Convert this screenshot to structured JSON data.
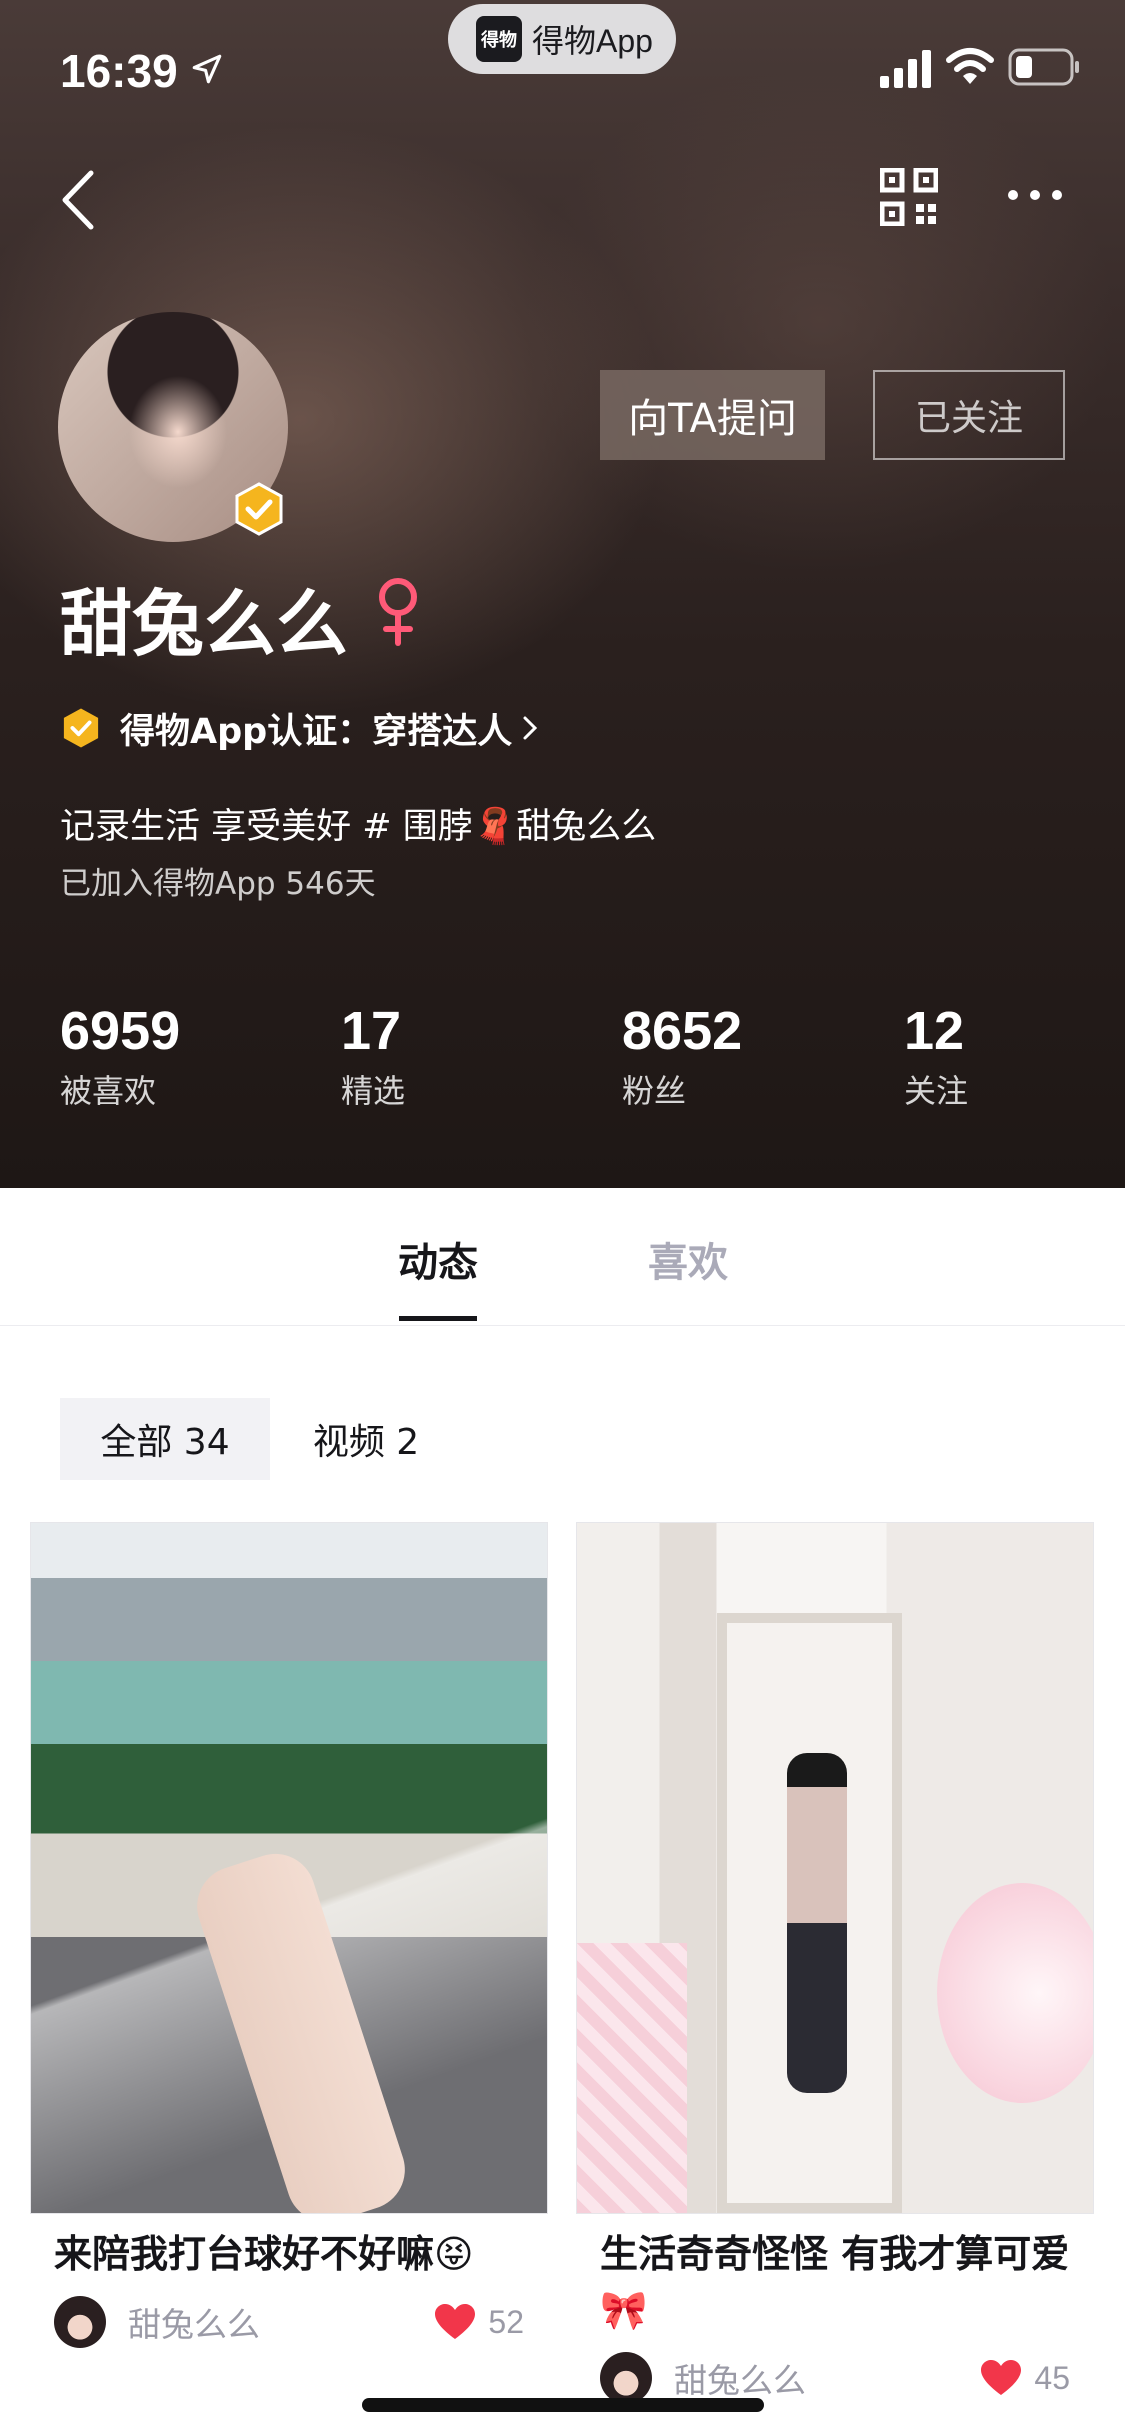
{
  "status_bar": {
    "time": "16:39",
    "app_pill_logo": "得物",
    "app_pill_text": "得物App",
    "icons": [
      "location-arrow-icon",
      "signal-icon",
      "wifi-icon",
      "battery-icon"
    ]
  },
  "nav": {
    "icons": [
      "back-icon",
      "qr-code-icon",
      "more-icon"
    ]
  },
  "profile": {
    "username": "甜兔么么",
    "gender": "female",
    "ask_button": "向TA提问",
    "follow_button": "已关注",
    "certification": "得物App认证：穿搭达人",
    "bio": "记录生活 享受美好 # 围脖🧣甜兔么么",
    "joined": "已加入得物App 546天"
  },
  "stats": [
    {
      "value": "6959",
      "label": "被喜欢"
    },
    {
      "value": "17",
      "label": "精选"
    },
    {
      "value": "8652",
      "label": "粉丝"
    },
    {
      "value": "12",
      "label": "关注"
    }
  ],
  "tabs": [
    {
      "label": "动态",
      "active": true
    },
    {
      "label": "喜欢",
      "active": false
    }
  ],
  "filters": [
    {
      "label": "全部 34",
      "active": true
    },
    {
      "label": "视频 2",
      "active": false
    }
  ],
  "cards": [
    {
      "title": "来陪我打台球好不好嘛😝",
      "author": "甜兔么么",
      "likes": "52"
    },
    {
      "title": "生活奇奇怪怪 有我才算可爱🎀",
      "author": "甜兔么么",
      "likes": "45"
    }
  ],
  "colors": {
    "accent_badge": "#f5b51e",
    "gender_pink": "#ff5a78",
    "heart_red": "#f2364a"
  }
}
